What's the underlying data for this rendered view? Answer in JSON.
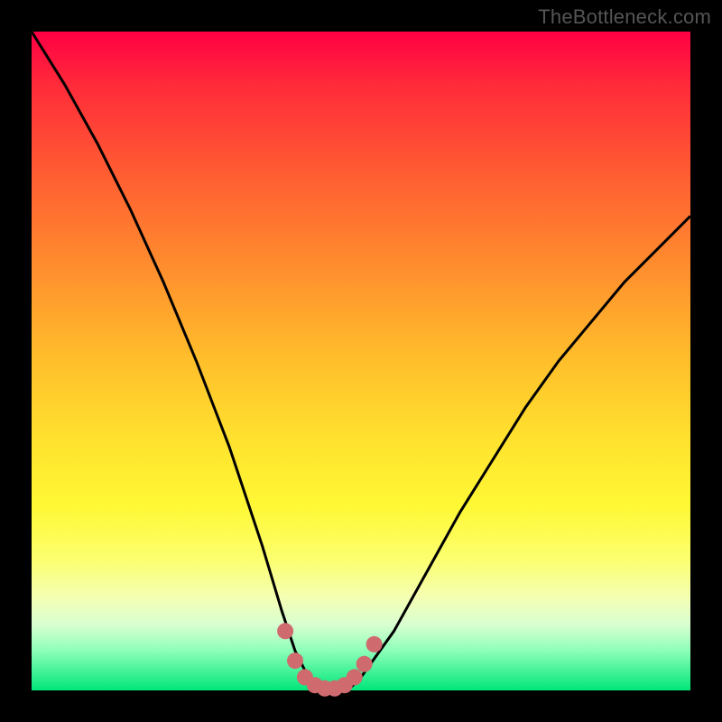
{
  "watermark": "TheBottleneck.com",
  "colors": {
    "frame": "#000000",
    "gradient_top": "#ff0044",
    "gradient_bottom": "#00e67a",
    "curve_stroke": "#000000",
    "marker_fill": "#cf6a6f",
    "marker_stroke": "#cf6a6f"
  },
  "chart_data": {
    "type": "line",
    "title": "",
    "xlabel": "",
    "ylabel": "",
    "xlim": [
      0,
      100
    ],
    "ylim": [
      0,
      100
    ],
    "grid": false,
    "series": [
      {
        "name": "bottleneck-curve",
        "x": [
          0,
          5,
          10,
          15,
          20,
          25,
          30,
          35,
          38,
          40,
          42,
          44,
          46,
          48,
          50,
          55,
          60,
          65,
          70,
          75,
          80,
          85,
          90,
          95,
          100
        ],
        "y": [
          100,
          92,
          83,
          73,
          62,
          50,
          37,
          22,
          12,
          6,
          2,
          0,
          0,
          0,
          2,
          9,
          18,
          27,
          35,
          43,
          50,
          56,
          62,
          67,
          72
        ]
      }
    ],
    "markers": {
      "name": "optimal-range",
      "x": [
        38.5,
        40,
        41.5,
        43,
        44.5,
        46,
        47.5,
        49,
        50.5,
        52
      ],
      "y": [
        9,
        4.5,
        2,
        0.8,
        0.3,
        0.3,
        0.8,
        2,
        4,
        7
      ]
    }
  }
}
